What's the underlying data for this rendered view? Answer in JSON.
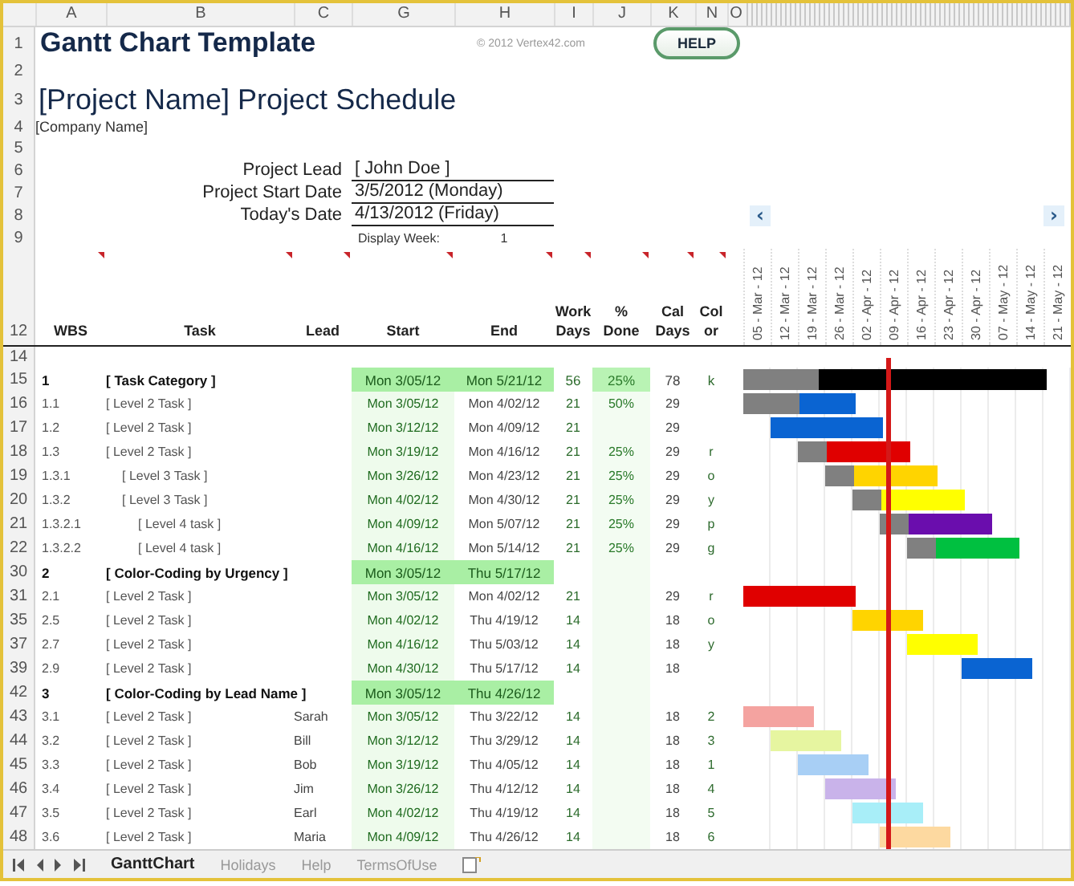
{
  "column_headers": [
    "A",
    "B",
    "C",
    "G",
    "H",
    "I",
    "J",
    "K",
    "N",
    "O"
  ],
  "top_row_numbers": [
    "1",
    "2",
    "3",
    "4",
    "5",
    "6",
    "7",
    "8",
    "9"
  ],
  "title": "Gantt Chart Template",
  "copyright": "© 2012 Vertex42.com",
  "help_button": "HELP",
  "project_title": "[Project Name] Project Schedule",
  "company": "[Company Name]",
  "fields": [
    {
      "label": "Project Lead",
      "value": "[ John Doe ]"
    },
    {
      "label": "Project Start Date",
      "value": "3/5/2012 (Monday)"
    },
    {
      "label": "Today's Date",
      "value": "4/13/2012 (Friday)"
    }
  ],
  "display_week": {
    "label": "Display Week:",
    "value": "1"
  },
  "timeline_nav": {
    "prev": "‹",
    "next": "›"
  },
  "table": {
    "header_row": "12",
    "spacer_row": "14",
    "columns": [
      "WBS",
      "Task",
      "Lead",
      "Start",
      "End",
      "Work Days",
      "% Done",
      "Cal Days",
      "Color"
    ],
    "weeks": [
      "05 - Mar - 12",
      "12 - Mar - 12",
      "19 - Mar - 12",
      "26 - Mar - 12",
      "02 - Apr - 12",
      "09 - Apr - 12",
      "16 - Apr - 12",
      "23 - Apr - 12",
      "30 - Apr - 12",
      "07 - May - 12",
      "14 - May - 12",
      "21 - May - 12"
    ],
    "rows": [
      {
        "row": "15",
        "kind": "category",
        "wbs": "1",
        "task": "[ Task Category ]",
        "start": "Mon 3/05/12",
        "end": "Mon 5/21/12",
        "work_days": "56",
        "done": "25%",
        "cal_days": "78",
        "color_code": "k",
        "color": "#000000",
        "children": [
          {
            "row": "16",
            "kind": "task",
            "wbs": "1.1",
            "task": "[ Level 2 Task ]",
            "start": "Mon 3/05/12",
            "end": "Mon 4/02/12",
            "work_days": "21",
            "done": "50%",
            "cal_days": "29",
            "color": "#0a64d2"
          },
          {
            "row": "17",
            "kind": "task",
            "wbs": "1.2",
            "task": "[ Level 2 Task ]",
            "start": "Mon 3/12/12",
            "end": "Mon 4/09/12",
            "work_days": "21",
            "cal_days": "29",
            "color": "#0a64d2"
          },
          {
            "row": "18",
            "kind": "task",
            "wbs": "1.3",
            "task": "[ Level 2 Task ]",
            "start": "Mon 3/19/12",
            "end": "Mon 4/16/12",
            "work_days": "21",
            "done": "25%",
            "cal_days": "29",
            "color_code": "r",
            "color": "#e00000",
            "children": [
              {
                "row": "19",
                "kind": "task",
                "wbs": "1.3.1",
                "task": "[ Level 3 Task ]",
                "start": "Mon 3/26/12",
                "end": "Mon 4/23/12",
                "work_days": "21",
                "done": "25%",
                "cal_days": "29",
                "color_code": "o",
                "color": "#ffd400"
              },
              {
                "row": "20",
                "kind": "task",
                "wbs": "1.3.2",
                "task": "[ Level 3 Task ]",
                "start": "Mon 4/02/12",
                "end": "Mon 4/30/12",
                "work_days": "21",
                "done": "25%",
                "cal_days": "29",
                "color_code": "y",
                "color": "#ffff00",
                "children": [
                  {
                    "row": "21",
                    "kind": "task",
                    "wbs": "1.3.2.1",
                    "task": "[ Level 4 task ]",
                    "start": "Mon 4/09/12",
                    "end": "Mon 5/07/12",
                    "work_days": "21",
                    "done": "25%",
                    "cal_days": "29",
                    "color_code": "p",
                    "color": "#6a0dad"
                  },
                  {
                    "row": "22",
                    "kind": "task",
                    "wbs": "1.3.2.2",
                    "task": "[ Level 4 task ]",
                    "start": "Mon 4/16/12",
                    "end": "Mon 5/14/12",
                    "work_days": "21",
                    "done": "25%",
                    "cal_days": "29",
                    "color_code": "g",
                    "color": "#00c040"
                  }
                ]
              }
            ]
          }
        ]
      },
      {
        "row": "30",
        "kind": "category",
        "wbs": "2",
        "task": "[ Color-Coding by Urgency ]",
        "start": "Mon 3/05/12",
        "end": "Thu 5/17/12",
        "children": [
          {
            "row": "31",
            "kind": "task",
            "wbs": "2.1",
            "task": "[ Level 2 Task ]",
            "start": "Mon 3/05/12",
            "end": "Mon 4/02/12",
            "work_days": "21",
            "cal_days": "29",
            "color_code": "r",
            "color": "#e00000"
          },
          {
            "row": "35",
            "kind": "task",
            "wbs": "2.5",
            "task": "[ Level 2 Task ]",
            "start": "Mon 4/02/12",
            "end": "Thu 4/19/12",
            "work_days": "14",
            "cal_days": "18",
            "color_code": "o",
            "color": "#ffd400"
          },
          {
            "row": "37",
            "kind": "task",
            "wbs": "2.7",
            "task": "[ Level 2 Task ]",
            "start": "Mon 4/16/12",
            "end": "Thu 5/03/12",
            "work_days": "14",
            "cal_days": "18",
            "color_code": "y",
            "color": "#ffff00"
          },
          {
            "row": "39",
            "kind": "task",
            "wbs": "2.9",
            "task": "[ Level 2 Task ]",
            "start": "Mon 4/30/12",
            "end": "Thu 5/17/12",
            "work_days": "14",
            "cal_days": "18",
            "color": "#0a64d2"
          }
        ]
      },
      {
        "row": "42",
        "kind": "category",
        "wbs": "3",
        "task": "[ Color-Coding by Lead Name ]",
        "start": "Mon 3/05/12",
        "end": "Thu 4/26/12",
        "children": [
          {
            "row": "43",
            "kind": "task",
            "wbs": "3.1",
            "task": "[ Level 2 Task ]",
            "lead": "Sarah",
            "start": "Mon 3/05/12",
            "end": "Thu 3/22/12",
            "work_days": "14",
            "cal_days": "18",
            "color_code": "2",
            "color": "#f4a3a0"
          },
          {
            "row": "44",
            "kind": "task",
            "wbs": "3.2",
            "task": "[ Level 2 Task ]",
            "lead": "Bill",
            "start": "Mon 3/12/12",
            "end": "Thu 3/29/12",
            "work_days": "14",
            "cal_days": "18",
            "color_code": "3",
            "color": "#e6f5a0"
          },
          {
            "row": "45",
            "kind": "task",
            "wbs": "3.3",
            "task": "[ Level 2 Task ]",
            "lead": "Bob",
            "start": "Mon 3/19/12",
            "end": "Thu 4/05/12",
            "work_days": "14",
            "cal_days": "18",
            "color_code": "1",
            "color": "#a8cff5"
          },
          {
            "row": "46",
            "kind": "task",
            "wbs": "3.4",
            "task": "[ Level 2 Task ]",
            "lead": "Jim",
            "start": "Mon 3/26/12",
            "end": "Thu 4/12/12",
            "work_days": "14",
            "cal_days": "18",
            "color_code": "4",
            "color": "#c9b3ea"
          },
          {
            "row": "47",
            "kind": "task",
            "wbs": "3.5",
            "task": "[ Level 2 Task ]",
            "lead": "Earl",
            "start": "Mon 4/02/12",
            "end": "Thu 4/19/12",
            "work_days": "14",
            "cal_days": "18",
            "color_code": "5",
            "color": "#a8eef8"
          },
          {
            "row": "48",
            "kind": "task",
            "wbs": "3.6",
            "task": "[ Level 2 Task ]",
            "lead": "Maria",
            "start": "Mon 4/09/12",
            "end": "Thu 4/26/12",
            "work_days": "14",
            "cal_days": "18",
            "color_code": "6",
            "color": "#fdd9a0"
          }
        ]
      }
    ]
  },
  "sheet_tabs": [
    {
      "label": "GanttChart",
      "selected": true
    },
    {
      "label": "Holidays",
      "selected": false
    },
    {
      "label": "Help",
      "selected": false
    },
    {
      "label": "TermsOfUse",
      "selected": false
    }
  ]
}
